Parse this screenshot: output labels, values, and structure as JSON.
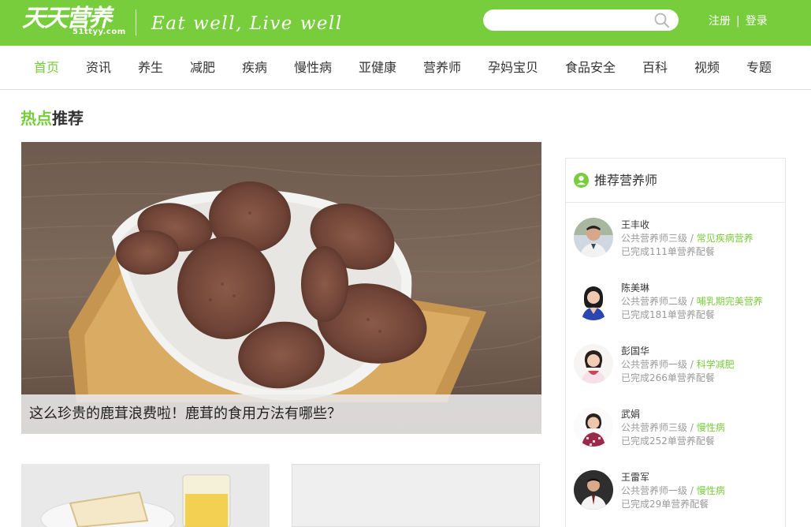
{
  "header": {
    "logo_text": "天天营养",
    "logo_sub": "51ttyy.com",
    "slogan": "Eat well, Live well",
    "search_placeholder": "",
    "register_label": "注册",
    "separator": "|",
    "login_label": "登录",
    "brand_color": "#78cd3d"
  },
  "nav": {
    "items": [
      {
        "label": "首页",
        "active": true
      },
      {
        "label": "资讯"
      },
      {
        "label": "养生"
      },
      {
        "label": "减肥"
      },
      {
        "label": "疾病"
      },
      {
        "label": "慢性病"
      },
      {
        "label": "亚健康"
      },
      {
        "label": "营养师"
      },
      {
        "label": "孕妈宝贝"
      },
      {
        "label": "食品安全"
      },
      {
        "label": "百科"
      },
      {
        "label": "视频"
      },
      {
        "label": "专题"
      }
    ]
  },
  "section": {
    "title_highlight": "热点",
    "title_rest": "推荐"
  },
  "hero": {
    "caption": "这么珍贵的鹿茸浪费啦！鹿茸的食用方法有哪些？",
    "image_subject": "deer-antler-slices-in-bowl"
  },
  "cards": [
    {
      "image_subject": "toast-and-juice"
    },
    {
      "image_subject": "placeholder"
    }
  ],
  "sidebar": {
    "title": "推荐营养师",
    "nutritionists": [
      {
        "name": "王丰收",
        "level": "公共营养师三级",
        "separator": "/",
        "specialty": "常见疾病营养",
        "orders": "已完成111单营养配餐"
      },
      {
        "name": "陈美琳",
        "level": "公共营养师二级",
        "separator": "/",
        "specialty": "哺乳期完美营养",
        "orders": "已完成181单营养配餐"
      },
      {
        "name": "彭国华",
        "level": "公共营养师一级",
        "separator": "/",
        "specialty": "科学减肥",
        "orders": "已完成266单营养配餐"
      },
      {
        "name": "武娟",
        "level": "公共营养师三级",
        "separator": "/",
        "specialty": "慢性病",
        "orders": "已完成252单营养配餐"
      },
      {
        "name": "王雷军",
        "level": "公共营养师一级",
        "separator": "/",
        "specialty": "慢性病",
        "orders": "已完成29单营养配餐"
      }
    ]
  }
}
